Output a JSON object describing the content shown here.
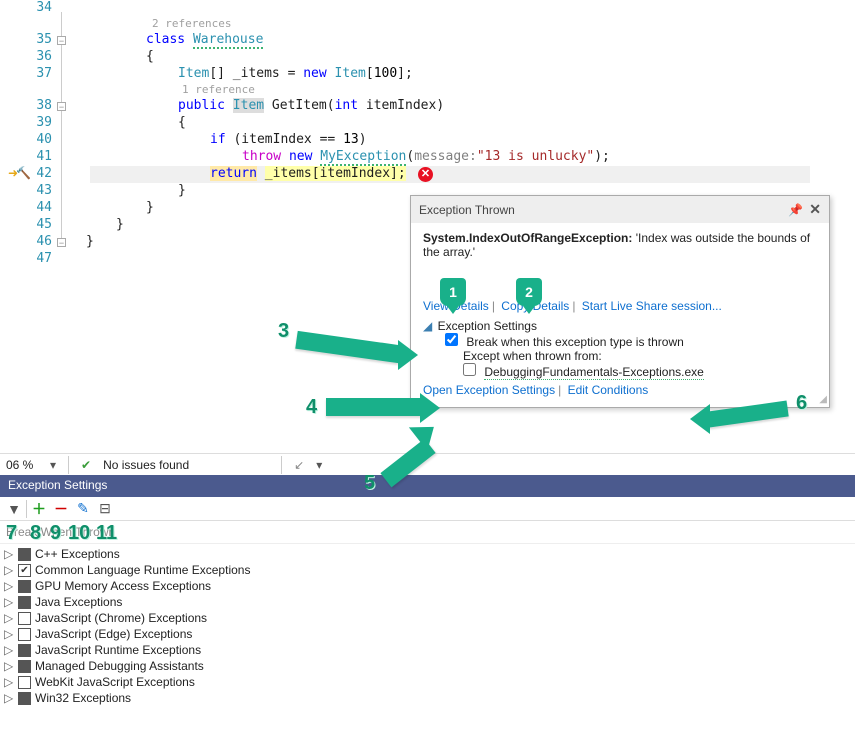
{
  "code": {
    "lines": [
      {
        "num": 34
      },
      {
        "num": 35,
        "fold": "-",
        "ref": "2 references",
        "text": "class Warehouse",
        "pre": "class",
        "cls": " Warehouse"
      },
      {
        "num": 36,
        "text": "{"
      },
      {
        "num": 37,
        "text": "Item[] _items = new Item[100];",
        "render": "items"
      },
      {
        "num": 38,
        "fold": "-",
        "ref": "1 reference",
        "text": "public Item GetItem(int itemIndex)",
        "render": "sig"
      },
      {
        "num": 39,
        "text": "{"
      },
      {
        "num": 40,
        "text": "if (itemIndex == 13)",
        "render": "if"
      },
      {
        "num": 41,
        "text": "throw new MyException(message:\"13 is unlucky\");",
        "render": "throw"
      },
      {
        "num": 42,
        "text": "return _items[itemIndex];",
        "render": "return"
      },
      {
        "num": 43,
        "text": "}"
      },
      {
        "num": 44,
        "text": "}"
      },
      {
        "num": 45,
        "text": "}"
      },
      {
        "num": 46,
        "text": "}"
      },
      {
        "num": 47
      }
    ]
  },
  "exception": {
    "title": "Exception Thrown",
    "type": "System.IndexOutOfRangeException:",
    "message": "'Index was outside the bounds of the array.'",
    "links": {
      "view": "View Details",
      "copy": "Copy Details",
      "live": "Start Live Share session..."
    },
    "settings_header": "Exception Settings",
    "break_label": "Break when this exception type is thrown",
    "except_label": "Except when thrown from:",
    "except_item": "DebuggingFundamentals-Exceptions.exe",
    "open": "Open Exception Settings",
    "edit": "Edit Conditions"
  },
  "status": {
    "zoom": "06 %",
    "issues": "No issues found"
  },
  "panel": {
    "title": "Exception Settings",
    "desc": "Break When Thrown",
    "categories": [
      {
        "label": "C++ Exceptions",
        "state": "filled"
      },
      {
        "label": "Common Language Runtime Exceptions",
        "state": "checked"
      },
      {
        "label": "GPU Memory Access Exceptions",
        "state": "filled"
      },
      {
        "label": "Java Exceptions",
        "state": "filled"
      },
      {
        "label": "JavaScript (Chrome) Exceptions",
        "state": "empty"
      },
      {
        "label": "JavaScript (Edge) Exceptions",
        "state": "empty"
      },
      {
        "label": "JavaScript Runtime Exceptions",
        "state": "filled"
      },
      {
        "label": "Managed Debugging Assistants",
        "state": "filled"
      },
      {
        "label": "WebKit JavaScript Exceptions",
        "state": "empty"
      },
      {
        "label": "Win32 Exceptions",
        "state": "filled"
      }
    ]
  },
  "annotations": {
    "call1": "1",
    "call2": "2",
    "n3": "3",
    "n4": "4",
    "n5": "5",
    "n6": "6",
    "n7": "7",
    "n8": "8",
    "n9": "9",
    "n10": "10",
    "n11": "11"
  }
}
